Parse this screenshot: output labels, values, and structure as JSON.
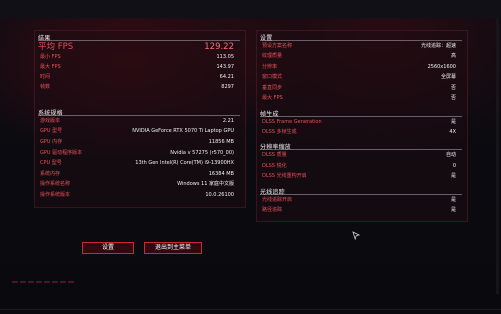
{
  "left": {
    "results": {
      "title": "结果",
      "rows": [
        {
          "label": "平均 FPS",
          "value": "129.22"
        },
        {
          "label": "最小 FPS",
          "value": "113.05"
        },
        {
          "label": "最大 FPS",
          "value": "143.97"
        },
        {
          "label": "时间",
          "value": "64.21"
        },
        {
          "label": "帧数",
          "value": "8297"
        }
      ]
    },
    "sysinfo": {
      "title": "系统规格",
      "rows": [
        {
          "label": "游戏版本",
          "value": "2.21"
        },
        {
          "label": "GPU 型号",
          "value": "NVIDIA GeForce RTX 5070 Ti Laptop GPU"
        },
        {
          "label": "GPU 内存",
          "value": "11856 MB"
        },
        {
          "label": "GPU 驱动程序版本",
          "value": "Nvidia v 57275 (r570_00)"
        },
        {
          "label": "CPU 型号",
          "value": "13th Gen Intel(R) Core(TM) i9-13900HX"
        },
        {
          "label": "系统内存",
          "value": "16384 MB"
        },
        {
          "label": "操作系统名称",
          "value": "Windows 11 家庭中文版"
        },
        {
          "label": "操作系统版本",
          "value": "10.0.26100"
        }
      ]
    }
  },
  "right": {
    "settings": {
      "title": "设置",
      "rows": [
        {
          "label": "预设方案名称",
          "value": "光线追踪：超速"
        },
        {
          "label": "纹理质量",
          "value": "高"
        },
        {
          "label": "分辨率",
          "value": "2560x1600"
        },
        {
          "label": "窗口模式",
          "value": "全屏幕"
        },
        {
          "label": "垂直同步",
          "value": "否"
        },
        {
          "label": "最大 FPS",
          "value": "否"
        }
      ]
    },
    "framegen": {
      "title": "帧生成",
      "rows": [
        {
          "label": "DLSS Frame Generation",
          "value": "是"
        },
        {
          "label": "DLSS 多帧生成",
          "value": "4X"
        }
      ]
    },
    "upscale": {
      "title": "分辨率缩放",
      "rows": [
        {
          "label": "DLSS 质量",
          "value": "自动"
        },
        {
          "label": "DLSS 锐化",
          "value": "0"
        },
        {
          "label": "DLSS 光线重构开启",
          "value": "是"
        }
      ]
    },
    "raytracing": {
      "title": "光线追踪",
      "rows": [
        {
          "label": "光线追踪开启",
          "value": "是"
        },
        {
          "label": "路径追踪",
          "value": "是"
        }
      ]
    }
  },
  "buttons": {
    "settings_label": "设置",
    "exit_label": "退出到主菜单"
  },
  "colors": {
    "label_red": "#e8505a",
    "highlight_red": "#ff6b78",
    "button_border": "#c8283a"
  }
}
